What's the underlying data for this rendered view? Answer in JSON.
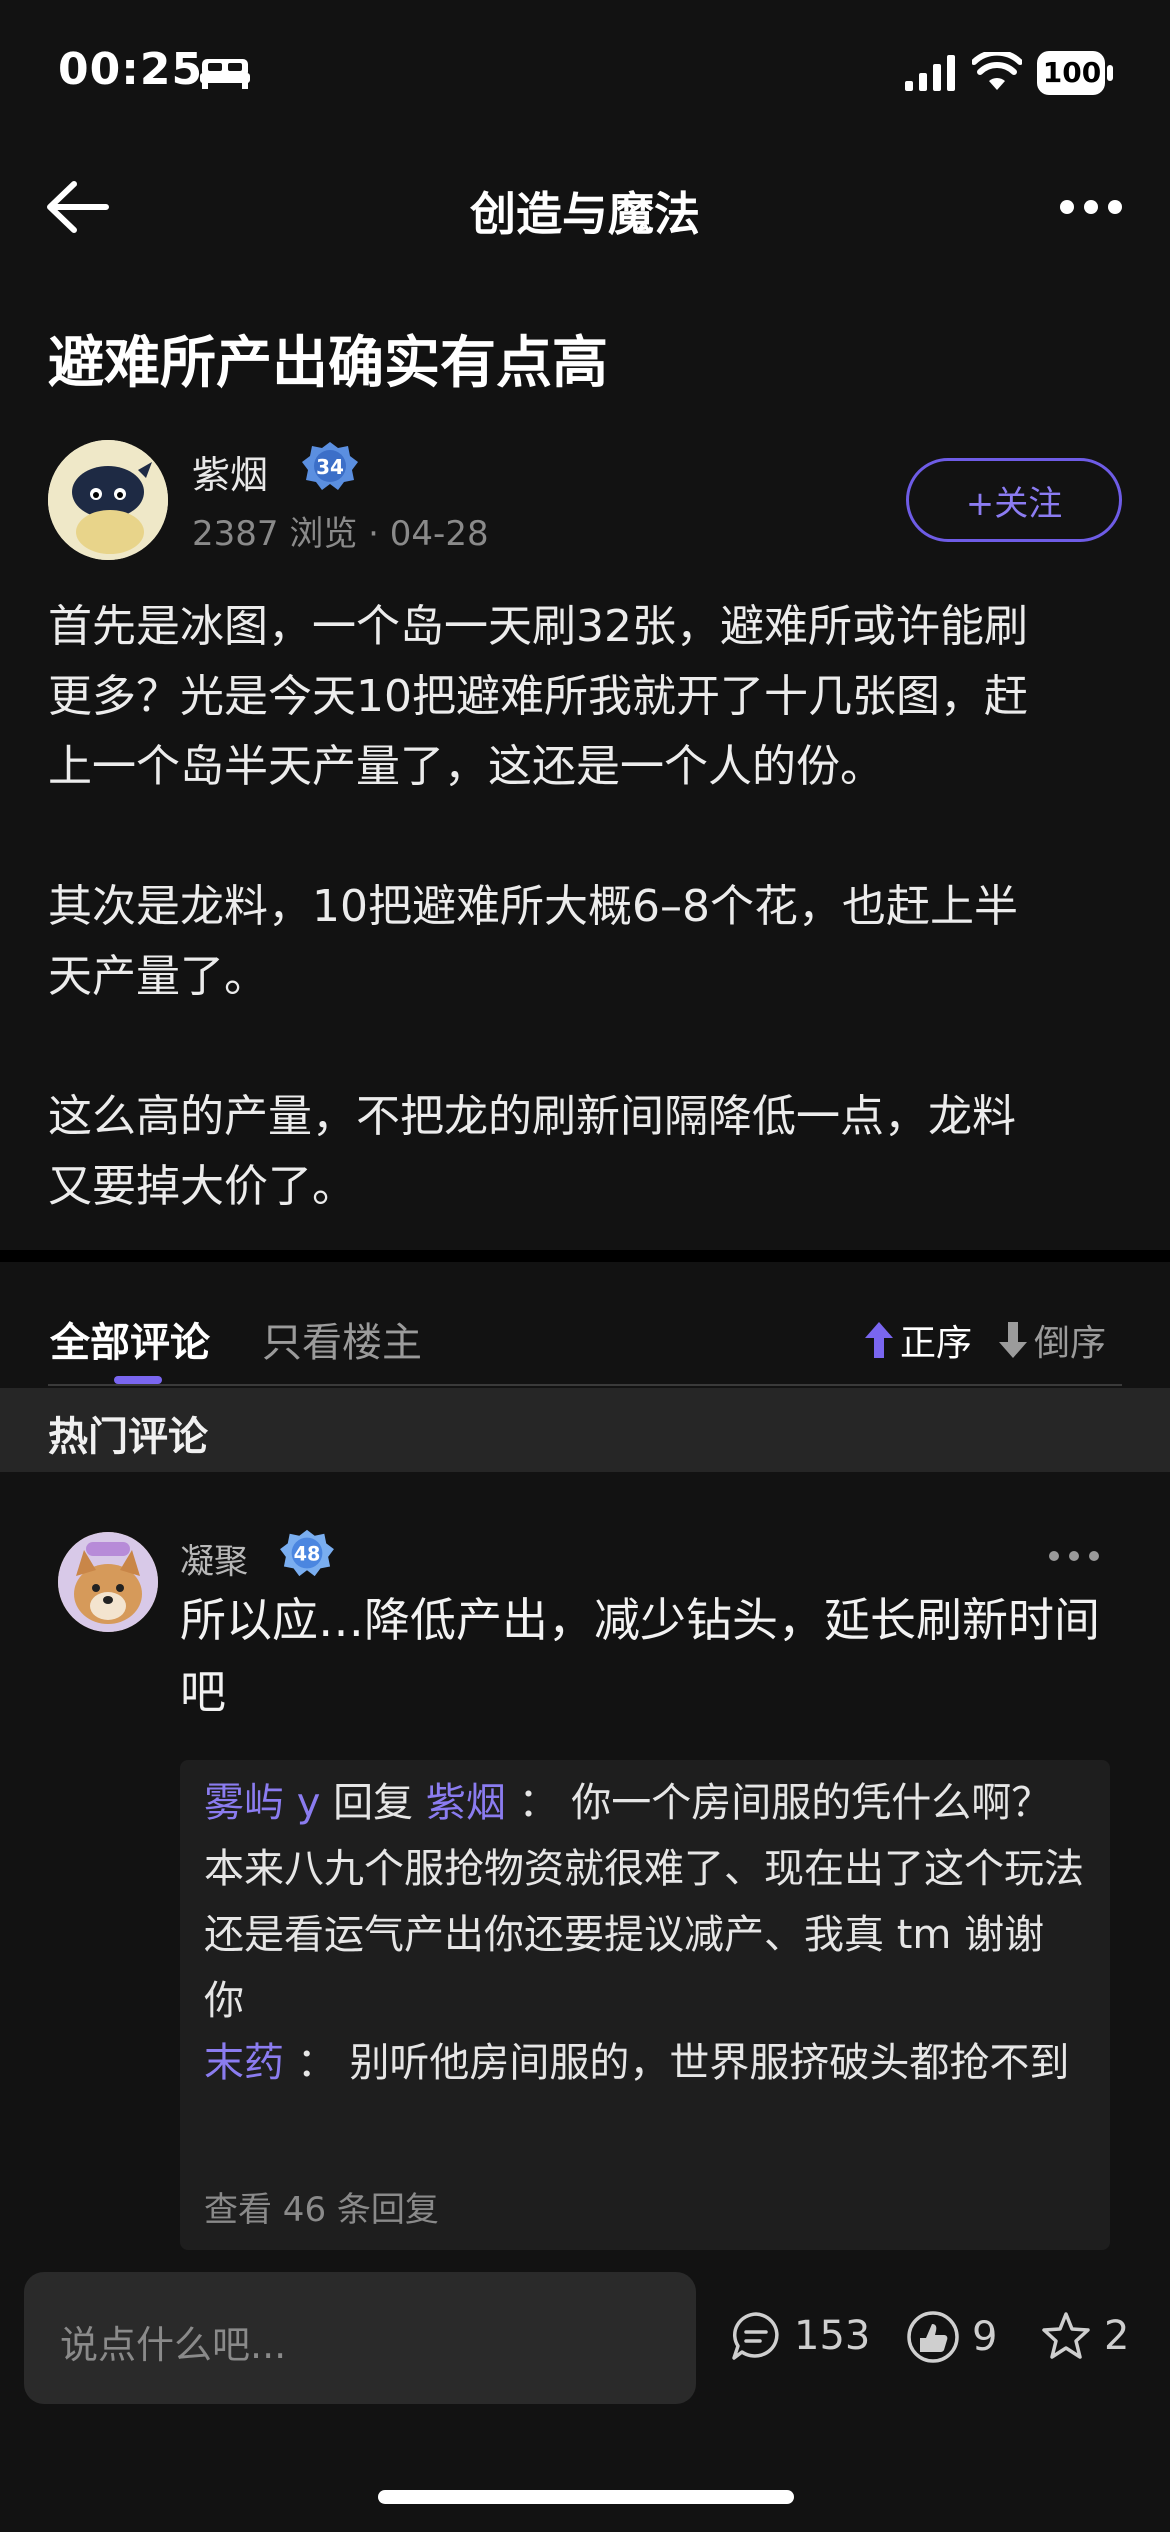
{
  "status": {
    "time": "00:25",
    "battery": "100"
  },
  "nav": {
    "title": "创造与魔法"
  },
  "post": {
    "title": "避难所产出确实有点高",
    "author": {
      "name": "紫烟",
      "level": "34",
      "views": "2387 浏览",
      "date": "04-28"
    },
    "follow_label": "+关注",
    "body": "首先是冰图，一个岛一天刷32张，避难所或许能刷\n更多？光是今天10把避难所我就开了十几张图，赶\n上一个岛半天产量了，这还是一个人的份。\n\n其次是龙料，10把避难所大概6–8个花，也赶上半\n天产量了。\n\n这么高的产量，不把龙的刷新间隔降低一点，龙料\n又要掉大价了。"
  },
  "tabs": {
    "all": "全部评论",
    "owner_only": "只看楼主",
    "sort_asc": "正序",
    "sort_desc": "倒序"
  },
  "hot_label": "热门评论",
  "comment": {
    "author": "凝聚",
    "level": "48",
    "text": "所以应…降低产出，减少钻头，延长刷新时间吧",
    "replies": [
      {
        "user": "雾屿 y",
        "action": "回复",
        "target": "紫烟",
        "sep": "：",
        "text": "你一个房间服的凭什么啊？本来八九个服抢物资就很难了、现在出了这个玩法还是看运气产出你还要提议减产、我真 tm 谢谢你"
      },
      {
        "user": "末药",
        "sep": "：",
        "text": "别听他房间服的，世界服挤破头都抢不到"
      }
    ],
    "view_replies": "查看 46 条回复"
  },
  "bottom": {
    "input_placeholder": "说点什么吧...",
    "comments": "153",
    "likes": "9",
    "favorites": "2"
  },
  "colors": {
    "accent": "#7a66f0",
    "background": "#121212"
  },
  "icons": [
    "bed-icon",
    "signal-icon",
    "wifi-icon",
    "battery-icon",
    "back-arrow-icon",
    "more-icon",
    "level-badge-icon",
    "arrow-up-icon",
    "arrow-down-icon",
    "comment-icon",
    "like-icon",
    "star-icon"
  ]
}
